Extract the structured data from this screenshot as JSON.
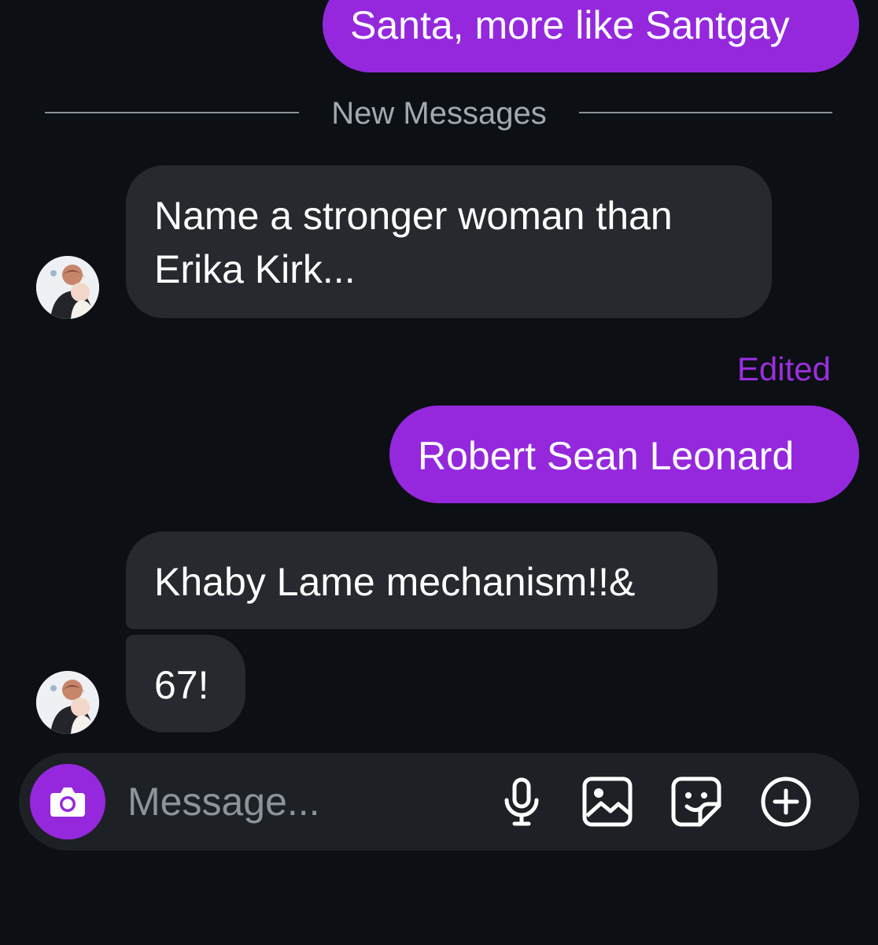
{
  "chat": {
    "messages": [
      {
        "sender": "me",
        "text": "Santa, more like Santgay"
      },
      {
        "sender": "other",
        "lines": [
          "Name a stronger woman than",
          "Erika Kirk..."
        ]
      },
      {
        "sender": "me",
        "status": "Edited",
        "text": "Robert Sean Leonard"
      },
      {
        "sender": "other",
        "text": "Khaby Lame mechanism!!&"
      },
      {
        "sender": "other",
        "text": "67!"
      }
    ],
    "divider_label": "New Messages"
  },
  "composer": {
    "placeholder": "Message...",
    "icons": [
      "camera-icon",
      "microphone-icon",
      "gallery-icon",
      "sticker-icon",
      "plus-icon"
    ]
  },
  "colors": {
    "background": "#0c0f14",
    "outgoing_bubble": "#9528dd",
    "incoming_bubble": "#26292e",
    "edited_label": "#9b2fde"
  }
}
